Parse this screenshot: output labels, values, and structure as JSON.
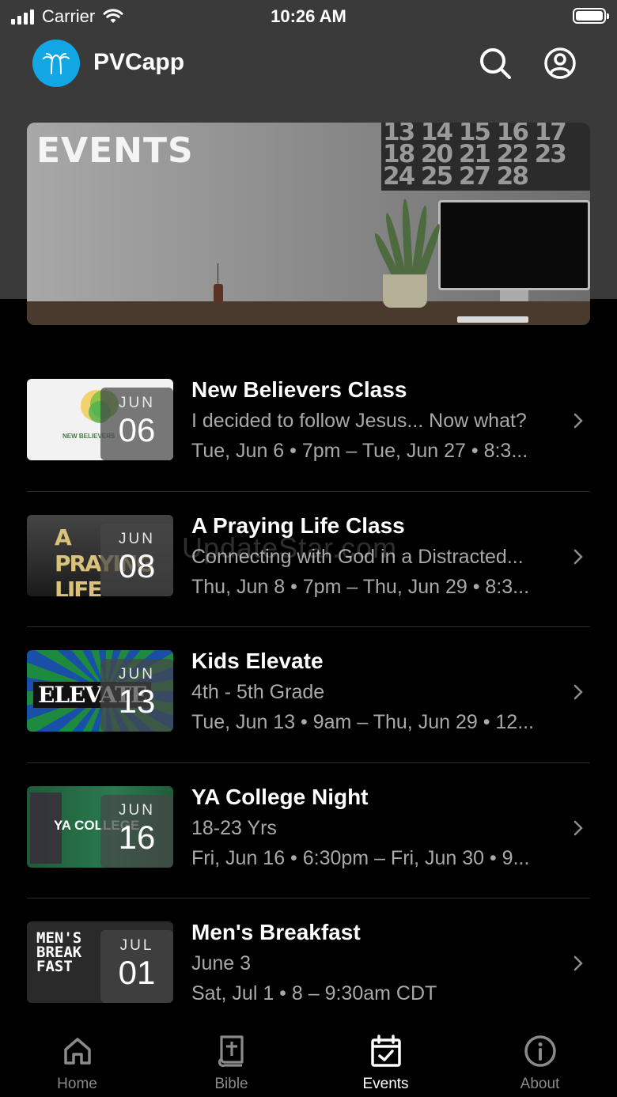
{
  "status_bar": {
    "carrier": "Carrier",
    "time": "10:26 AM"
  },
  "header": {
    "app_name": "PVCapp"
  },
  "banner": {
    "title": "EVENTS",
    "calendar_numbers": "13 14 15 16 17 18 20 21 22 23 24 25 27 28"
  },
  "events": [
    {
      "title": "New Believers Class",
      "subtitle": "I decided to follow Jesus... Now what?",
      "when": "Tue, Jun 6 • 7pm – Tue, Jun 27 • 8:3...",
      "month": "JUN",
      "day": "06",
      "thumb_text": "NEW BELIEVERS"
    },
    {
      "title": "A Praying Life Class",
      "subtitle": "Connecting with God in a Distracted...",
      "when": "Thu, Jun 8 • 7pm – Thu, Jun 29 • 8:3...",
      "month": "JUN",
      "day": "08",
      "thumb_text": "A PRAYING LIFE"
    },
    {
      "title": "Kids Elevate",
      "subtitle": "4th - 5th Grade",
      "when": "Tue, Jun 13 • 9am – Thu, Jun 29 • 12...",
      "month": "JUN",
      "day": "13",
      "thumb_text": "ELEVATE"
    },
    {
      "title": "YA College Night",
      "subtitle": "18-23 Yrs",
      "when": "Fri, Jun 16 • 6:30pm – Fri, Jun 30 • 9...",
      "month": "JUN",
      "day": "16",
      "thumb_text": "YA COLLEGE"
    },
    {
      "title": "Men's Breakfast",
      "subtitle": "June 3",
      "when": "Sat, Jul 1 • 8 – 9:30am CDT",
      "month": "JUL",
      "day": "01",
      "thumb_text": "MEN'S BREAK FAST"
    }
  ],
  "watermark": "UpdateStar.com",
  "tabs": [
    {
      "label": "Home",
      "icon": "home-icon",
      "active": false
    },
    {
      "label": "Bible",
      "icon": "bible-icon",
      "active": false
    },
    {
      "label": "Events",
      "icon": "calendar-check-icon",
      "active": true
    },
    {
      "label": "About",
      "icon": "info-icon",
      "active": false
    }
  ],
  "colors": {
    "accent": "#12a6e4",
    "header_bg": "#3a3a3a",
    "background": "#000000",
    "secondary_text": "#a9a9a9"
  }
}
